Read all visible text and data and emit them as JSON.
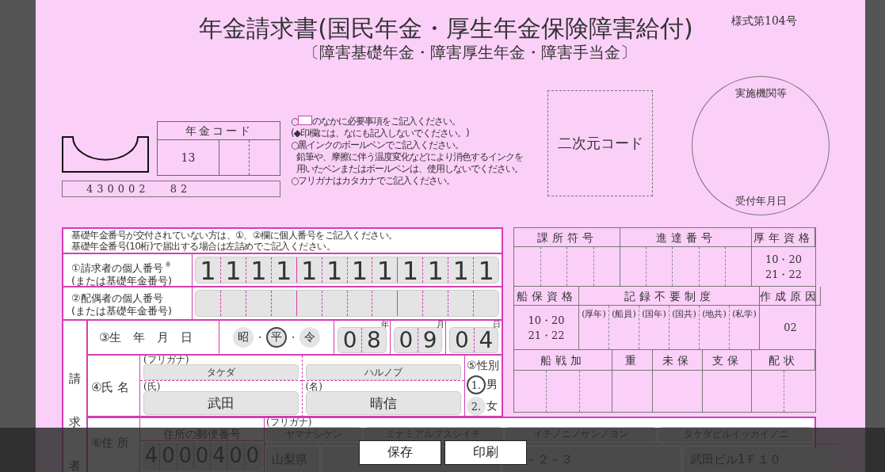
{
  "form_number": "様式第104号",
  "title": "年金請求書(国民年金・厚生年金保険障害給付)",
  "subtitle": "〔障害基礎年金・障害厚生年金・障害手当金〕",
  "pension_code": {
    "label": "年金コード",
    "values": [
      "13"
    ]
  },
  "code_strip": [
    "430002",
    "82"
  ],
  "notes": [
    {
      "kind": "boxed",
      "prefix": "○",
      "text": "のなかに必要事項をご記入ください。"
    },
    {
      "kind": "plain",
      "text": "(◆印欄には、なにも記入しないでください。)"
    },
    {
      "kind": "plain",
      "text": "○黒インクのボールペンでご記入ください。"
    },
    {
      "kind": "indent",
      "text": "鉛筆や、摩擦に伴う温度変化などにより消色するインクを"
    },
    {
      "kind": "indent",
      "text": "用いたペンまたはボールペンは、使用しないでください。"
    },
    {
      "kind": "plain",
      "text": "○フリガナはカタカナでご記入ください。"
    }
  ],
  "qr_label": "二次元コード",
  "stamp": {
    "top": "実施機関等",
    "bottom": "受付年月日"
  },
  "number_note": [
    "基礎年金番号が交付されていない方は、①、②欄に個人番号をご記入ください。",
    "基礎年金番号(10桁)で届出する場合は左詰めでご記入ください。"
  ],
  "id_rows": [
    {
      "label": [
        "①請求者の個人番号",
        "(または基礎年金番号)"
      ],
      "mark": "※",
      "digits": [
        "1",
        "1",
        "1",
        "1",
        "1",
        "1",
        "1",
        "1",
        "1",
        "1",
        "1",
        "1"
      ]
    },
    {
      "label": [
        "②配偶者の個人番号",
        "(または基礎年金番号)"
      ],
      "digits": []
    }
  ],
  "claimant_label": "請求者",
  "birth": {
    "label": "③生　年　月　日",
    "eras": [
      {
        "label": "昭",
        "selected": false
      },
      {
        "label": "平",
        "selected": true
      },
      {
        "label": "令",
        "selected": false
      }
    ],
    "separators": [
      "・",
      "・"
    ],
    "date": [
      {
        "unit": "年",
        "digits": [
          "0",
          "8"
        ]
      },
      {
        "unit": "月",
        "digits": [
          "0",
          "9"
        ]
      },
      {
        "unit": "日",
        "digits": [
          "0",
          "4"
        ]
      }
    ]
  },
  "name": {
    "label": "④氏 名",
    "furigana_label": "(フリガナ)",
    "parts": [
      {
        "label": "(氏)",
        "kana": "タケダ",
        "kanji": "武田"
      },
      {
        "label": "(名)",
        "kana": "ハルノブ",
        "kanji": "晴信"
      }
    ]
  },
  "sex": {
    "label": "⑤性別",
    "options": [
      {
        "number": "1.",
        "label": "男",
        "selected": true
      },
      {
        "number": "2.",
        "label": "女",
        "selected": false
      }
    ]
  },
  "address": {
    "label": "⑥住 所",
    "postcode_label": "住所の郵便番号",
    "postcode": [
      "4",
      "0",
      "0",
      "0",
      "4",
      "0",
      "0"
    ],
    "furigana_label": "(フリガナ)",
    "kana": [
      "ヤマナシケン",
      "ミナミアルプスシイチ",
      "イチノニノサンノヨン",
      "タケダビルイッカイノニ"
    ],
    "kanji": [
      "山梨県",
      "－２－３",
      "武田ビル1Ｆ１０"
    ]
  },
  "office_table": [
    {
      "headers": [
        "課所符号",
        "進達番号",
        "厚年資格"
      ],
      "cells": [
        {
          "kind": "blank"
        },
        {
          "kind": "blank"
        },
        {
          "kind": "values",
          "lines": [
            "10・20",
            "21・22"
          ]
        }
      ]
    },
    {
      "headers": [
        "船保資格",
        "記録不要制度",
        "作成原因"
      ],
      "cells": [
        {
          "kind": "values",
          "lines": [
            "10・20",
            "21・22"
          ]
        },
        {
          "kind": "labels",
          "lines": [
            "(厚年)",
            "(船員)",
            "(国年)",
            "(国共)",
            "(地共)",
            "(私学)"
          ]
        },
        {
          "kind": "value",
          "lines": [
            "02"
          ]
        }
      ]
    },
    {
      "headers": [
        "船戦加",
        "重",
        "未保",
        "支保",
        "配状"
      ],
      "cells": [
        {
          "kind": "blank"
        },
        {
          "kind": "blank"
        },
        {
          "kind": "blank"
        },
        {
          "kind": "blank"
        },
        {
          "kind": "blank"
        }
      ]
    }
  ],
  "buttons": [
    "保存",
    "印刷"
  ]
}
